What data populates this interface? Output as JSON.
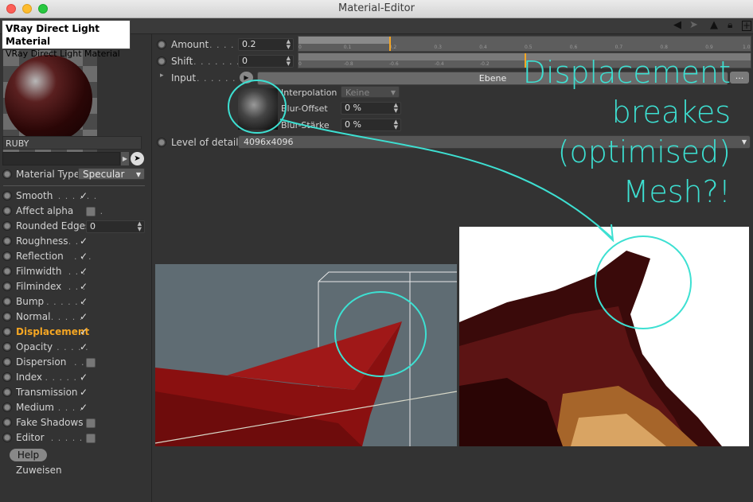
{
  "window": {
    "title": "Material-Editor"
  },
  "tooltip": {
    "title": "VRay Direct Light Material",
    "subtitle": "VRay Direct Light Material"
  },
  "material": {
    "name": "RUBY"
  },
  "material_type": {
    "label": "Material Type",
    "value": "Specular"
  },
  "channels": [
    {
      "label": "Smooth",
      "dots": ". . . . . . .",
      "state": "check"
    },
    {
      "label": "Affect alpha",
      "dots": ". . .",
      "state": "box"
    },
    {
      "label": "Rounded Edges",
      "dots": "",
      "state": "field",
      "value": "0"
    },
    {
      "label": "Roughness",
      "dots": ". .",
      "state": "check"
    },
    {
      "label": "Reflection",
      "dots": ". . .",
      "state": "check"
    },
    {
      "label": "Filmwidth",
      "dots": ". . .",
      "state": "check"
    },
    {
      "label": "Filmindex",
      "dots": ". . .",
      "state": "check"
    },
    {
      "label": "Bump",
      "dots": ". . . . . . .",
      "state": "check"
    },
    {
      "label": "Normal",
      "dots": ". . . . .",
      "state": "check"
    },
    {
      "label": "Displacement",
      "dots": "",
      "state": "check",
      "active": true
    },
    {
      "label": "Opacity",
      "dots": ". . . . .",
      "state": "check"
    },
    {
      "label": "Dispersion",
      "dots": ". .",
      "state": "box"
    },
    {
      "label": "Index",
      "dots": ". . . . . .",
      "state": "check"
    },
    {
      "label": "Transmission",
      "dots": "",
      "state": "check"
    },
    {
      "label": "Medium",
      "dots": ". . . . .",
      "state": "check"
    },
    {
      "label": "Fake Shadows",
      "dots": "",
      "state": "box"
    },
    {
      "label": "Editor",
      "dots": ". . . . . . .",
      "state": "box"
    }
  ],
  "help_label": "Help",
  "assign_label": "Zuweisen",
  "params": {
    "amount": {
      "label": "Amount",
      "dots": ". . . . . .",
      "value": "0.2",
      "fraction": 0.2,
      "ticks": [
        "0",
        "0.1",
        "0.2",
        "0.3",
        "0.4",
        "0.5",
        "0.6",
        "0.7",
        "0.8",
        "0.9",
        "1.0"
      ]
    },
    "shift": {
      "label": "Shift",
      "dots": ". . . . . . . . .",
      "value": "0",
      "ticks": [
        "0",
        "-0.8",
        "-0.6",
        "-0.4",
        "-0.2",
        "0"
      ]
    },
    "input": {
      "label": "Input",
      "dots": ". . . . . . . .",
      "layer": "Ebene",
      "more": "..."
    },
    "interpolation": {
      "label": "Interpolation",
      "value": "Keine"
    },
    "blur_offset": {
      "label": "Blur-Offset",
      "value": "0 %"
    },
    "blur_strength": {
      "label": "Blur-Stärke",
      "value": "0 %"
    },
    "lod": {
      "label": "Level of details",
      "value": "4096x4096"
    }
  },
  "annotation": {
    "lines": [
      "Displacement",
      "breakes",
      "(optimised)",
      "Mesh?!"
    ],
    "color": "#3de0d2"
  },
  "colors": {
    "accent": "#f5a623",
    "background": "#333333"
  }
}
